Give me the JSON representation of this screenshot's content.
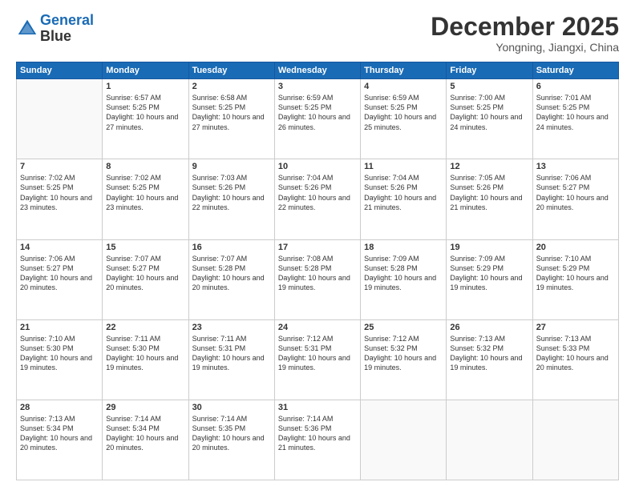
{
  "header": {
    "logo_line1": "General",
    "logo_line2": "Blue",
    "month": "December 2025",
    "location": "Yongning, Jiangxi, China"
  },
  "weekdays": [
    "Sunday",
    "Monday",
    "Tuesday",
    "Wednesday",
    "Thursday",
    "Friday",
    "Saturday"
  ],
  "weeks": [
    [
      {
        "day": "",
        "info": ""
      },
      {
        "day": "1",
        "info": "Sunrise: 6:57 AM\nSunset: 5:25 PM\nDaylight: 10 hours\nand 27 minutes."
      },
      {
        "day": "2",
        "info": "Sunrise: 6:58 AM\nSunset: 5:25 PM\nDaylight: 10 hours\nand 27 minutes."
      },
      {
        "day": "3",
        "info": "Sunrise: 6:59 AM\nSunset: 5:25 PM\nDaylight: 10 hours\nand 26 minutes."
      },
      {
        "day": "4",
        "info": "Sunrise: 6:59 AM\nSunset: 5:25 PM\nDaylight: 10 hours\nand 25 minutes."
      },
      {
        "day": "5",
        "info": "Sunrise: 7:00 AM\nSunset: 5:25 PM\nDaylight: 10 hours\nand 24 minutes."
      },
      {
        "day": "6",
        "info": "Sunrise: 7:01 AM\nSunset: 5:25 PM\nDaylight: 10 hours\nand 24 minutes."
      }
    ],
    [
      {
        "day": "7",
        "info": "Sunrise: 7:02 AM\nSunset: 5:25 PM\nDaylight: 10 hours\nand 23 minutes."
      },
      {
        "day": "8",
        "info": "Sunrise: 7:02 AM\nSunset: 5:25 PM\nDaylight: 10 hours\nand 23 minutes."
      },
      {
        "day": "9",
        "info": "Sunrise: 7:03 AM\nSunset: 5:26 PM\nDaylight: 10 hours\nand 22 minutes."
      },
      {
        "day": "10",
        "info": "Sunrise: 7:04 AM\nSunset: 5:26 PM\nDaylight: 10 hours\nand 22 minutes."
      },
      {
        "day": "11",
        "info": "Sunrise: 7:04 AM\nSunset: 5:26 PM\nDaylight: 10 hours\nand 21 minutes."
      },
      {
        "day": "12",
        "info": "Sunrise: 7:05 AM\nSunset: 5:26 PM\nDaylight: 10 hours\nand 21 minutes."
      },
      {
        "day": "13",
        "info": "Sunrise: 7:06 AM\nSunset: 5:27 PM\nDaylight: 10 hours\nand 20 minutes."
      }
    ],
    [
      {
        "day": "14",
        "info": "Sunrise: 7:06 AM\nSunset: 5:27 PM\nDaylight: 10 hours\nand 20 minutes."
      },
      {
        "day": "15",
        "info": "Sunrise: 7:07 AM\nSunset: 5:27 PM\nDaylight: 10 hours\nand 20 minutes."
      },
      {
        "day": "16",
        "info": "Sunrise: 7:07 AM\nSunset: 5:28 PM\nDaylight: 10 hours\nand 20 minutes."
      },
      {
        "day": "17",
        "info": "Sunrise: 7:08 AM\nSunset: 5:28 PM\nDaylight: 10 hours\nand 19 minutes."
      },
      {
        "day": "18",
        "info": "Sunrise: 7:09 AM\nSunset: 5:28 PM\nDaylight: 10 hours\nand 19 minutes."
      },
      {
        "day": "19",
        "info": "Sunrise: 7:09 AM\nSunset: 5:29 PM\nDaylight: 10 hours\nand 19 minutes."
      },
      {
        "day": "20",
        "info": "Sunrise: 7:10 AM\nSunset: 5:29 PM\nDaylight: 10 hours\nand 19 minutes."
      }
    ],
    [
      {
        "day": "21",
        "info": "Sunrise: 7:10 AM\nSunset: 5:30 PM\nDaylight: 10 hours\nand 19 minutes."
      },
      {
        "day": "22",
        "info": "Sunrise: 7:11 AM\nSunset: 5:30 PM\nDaylight: 10 hours\nand 19 minutes."
      },
      {
        "day": "23",
        "info": "Sunrise: 7:11 AM\nSunset: 5:31 PM\nDaylight: 10 hours\nand 19 minutes."
      },
      {
        "day": "24",
        "info": "Sunrise: 7:12 AM\nSunset: 5:31 PM\nDaylight: 10 hours\nand 19 minutes."
      },
      {
        "day": "25",
        "info": "Sunrise: 7:12 AM\nSunset: 5:32 PM\nDaylight: 10 hours\nand 19 minutes."
      },
      {
        "day": "26",
        "info": "Sunrise: 7:13 AM\nSunset: 5:32 PM\nDaylight: 10 hours\nand 19 minutes."
      },
      {
        "day": "27",
        "info": "Sunrise: 7:13 AM\nSunset: 5:33 PM\nDaylight: 10 hours\nand 20 minutes."
      }
    ],
    [
      {
        "day": "28",
        "info": "Sunrise: 7:13 AM\nSunset: 5:34 PM\nDaylight: 10 hours\nand 20 minutes."
      },
      {
        "day": "29",
        "info": "Sunrise: 7:14 AM\nSunset: 5:34 PM\nDaylight: 10 hours\nand 20 minutes."
      },
      {
        "day": "30",
        "info": "Sunrise: 7:14 AM\nSunset: 5:35 PM\nDaylight: 10 hours\nand 20 minutes."
      },
      {
        "day": "31",
        "info": "Sunrise: 7:14 AM\nSunset: 5:36 PM\nDaylight: 10 hours\nand 21 minutes."
      },
      {
        "day": "",
        "info": ""
      },
      {
        "day": "",
        "info": ""
      },
      {
        "day": "",
        "info": ""
      }
    ]
  ]
}
